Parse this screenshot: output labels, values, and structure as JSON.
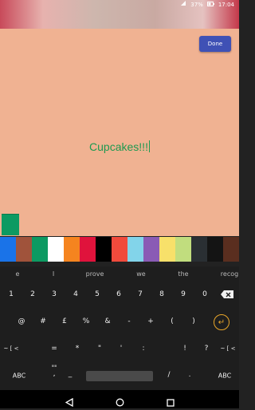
{
  "status_bar": {
    "battery": "37%",
    "time": "17:04"
  },
  "done_label": "Done",
  "canvas_text": "Cupcakes!!!",
  "colors": {
    "canvas_bg": "#f0b292",
    "text_color": "#1e9950",
    "current_color": "#0d9a62",
    "done_button": "#3f51b5",
    "keyboard_bg": "#1e1e1e",
    "enter_accent": "#e9a62a"
  },
  "palette": [
    "#1a73e8",
    "#a0533b",
    "#0d9a62",
    "#ffffff",
    "#f5841f",
    "#e0133c",
    "#000000",
    "#f04a3c",
    "#82d4ea",
    "#8a5bb5",
    "#f7e06a",
    "#c1dd7e",
    "#2a2f33",
    "#141414",
    "#5a2e1f"
  ],
  "suggestions": [
    "e",
    "I",
    "prove",
    "we",
    "the",
    "recog"
  ],
  "keyboard": {
    "row1": [
      "1",
      "2",
      "3",
      "4",
      "5",
      "6",
      "7",
      "8",
      "9",
      "0"
    ],
    "row2": [
      "@",
      "#",
      "£",
      "%",
      "&",
      "-",
      "+",
      "(",
      ")"
    ],
    "row3": [
      "~ [ <",
      "=",
      "*",
      "\"",
      "'",
      ":",
      "!",
      "?",
      "~ [ <"
    ],
    "row4": [
      "ABC",
      "_",
      "/",
      ".",
      "ABC"
    ],
    "icons": {
      "backspace": "backspace-icon",
      "enter": "enter-icon",
      "comma_hint": "comma-hint"
    }
  },
  "navbar_icons": [
    "back-icon",
    "home-icon",
    "recents-icon"
  ]
}
